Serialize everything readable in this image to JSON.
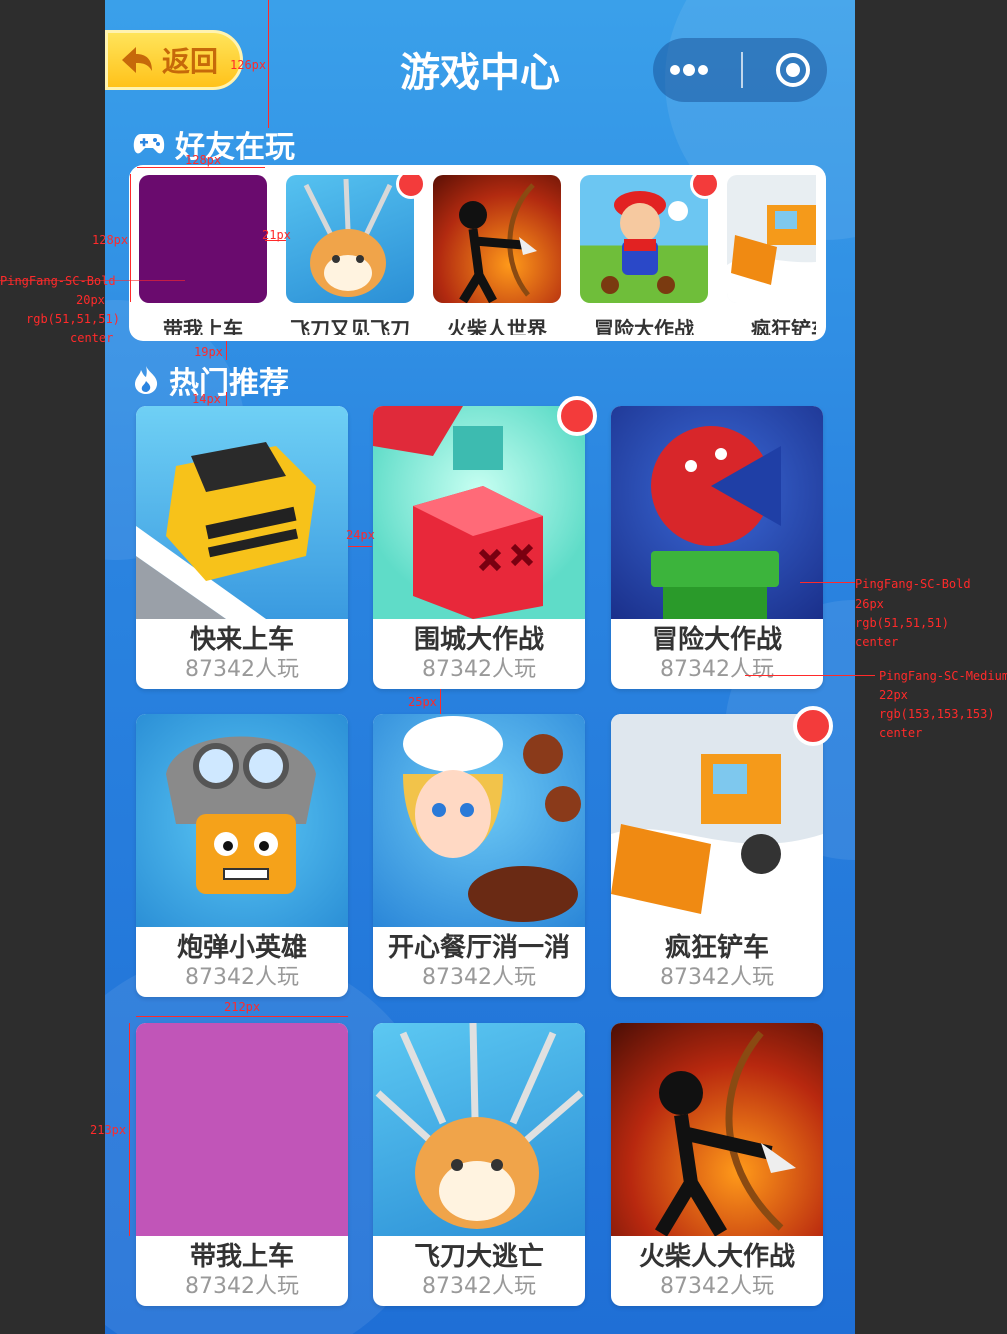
{
  "header": {
    "back_label": "返回",
    "title": "游戏中心",
    "menu_icon": "more-dots-icon",
    "close_icon": "target-circle-icon"
  },
  "friends_section": {
    "title": "好友在玩",
    "icon": "gamepad-icon",
    "items": [
      {
        "name": "带我上车",
        "color": "#6a0b6e",
        "badge": false
      },
      {
        "name": "飞刀又见飞刀",
        "color": "#3bb0e8",
        "badge": true
      },
      {
        "name": "火柴人世界",
        "color": "#b22a10",
        "badge": false
      },
      {
        "name": "冒险大作战",
        "color": "#57b7ea",
        "badge": true
      },
      {
        "name": "疯狂铲车",
        "color": "#e8eef2",
        "badge": false
      }
    ]
  },
  "hot_section": {
    "title": "热门推荐",
    "icon": "flame-icon",
    "items": [
      {
        "name": "快来上车",
        "plays": "87342人玩",
        "color": "#58b9ea",
        "badge": false
      },
      {
        "name": "围城大作战",
        "plays": "87342人玩",
        "color": "#6fe4d2",
        "badge": true
      },
      {
        "name": "冒险大作战",
        "plays": "87342人玩",
        "color": "#1f3fa6",
        "badge": false
      },
      {
        "name": "炮弹小英雄",
        "plays": "87342人玩",
        "color": "#2b8fd6",
        "badge": false
      },
      {
        "name": "开心餐厅消一消",
        "plays": "87342人玩",
        "color": "#2a86d8",
        "badge": false
      },
      {
        "name": "疯狂铲车",
        "plays": "87342人玩",
        "color": "#dfe7ee",
        "badge": true
      },
      {
        "name": "带我上车",
        "plays": "87342人玩",
        "color": "#c155b8",
        "badge": false
      },
      {
        "name": "飞刀大逃亡",
        "plays": "87342人玩",
        "color": "#3ab2ea",
        "badge": false
      },
      {
        "name": "火柴人大作战",
        "plays": "87342人玩",
        "color": "#b8280f",
        "badge": false
      }
    ]
  },
  "annotations": {
    "a1": "126px",
    "a2": "128px",
    "a3": "128px",
    "a4": "21px",
    "a5": "PingFang-SC-Bold",
    "a6": "20px",
    "a7": "rgb(51,51,51)",
    "a8": "center",
    "a9": "19px",
    "a10": "14px",
    "a11": "24px",
    "a12": "25px",
    "a13": "PingFang-SC-Bold",
    "a14": "26px",
    "a15": "rgb(51,51,51)",
    "a16": "center",
    "a17": "PingFang-SC-Medium",
    "a18": "22px",
    "a19": "rgb(153,153,153)",
    "a20": "center",
    "a21": "212px",
    "a22": "213px"
  }
}
